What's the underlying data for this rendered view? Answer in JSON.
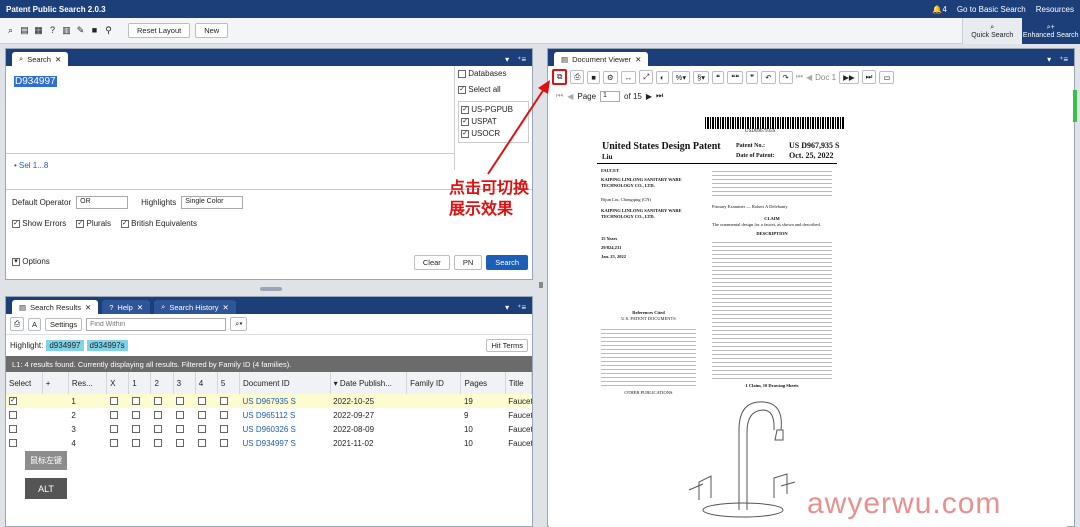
{
  "app": {
    "title": "Patent Public Search 2.0.3",
    "notif_count": "4",
    "basic_search_link": "Go to Basic Search",
    "resources": "Resources"
  },
  "toolbar": {
    "reset_layout": "Reset Layout",
    "new": "New",
    "quick_search": "Quick Search",
    "enhanced_search": "Enhanced Search"
  },
  "search": {
    "tab": "Search",
    "query": "D934997",
    "set_link": "• Sel 1...8",
    "databases_label": "Databases",
    "select_all": "Select all",
    "dbs": [
      "US-PGPUB",
      "USPAT",
      "USOCR"
    ],
    "default_operator_label": "Default Operator",
    "default_operator": "OR",
    "highlights_label": "Highlights",
    "highlights": "Single Color",
    "show_errors": "Show Errors",
    "plurals": "Plurals",
    "british": "British Equivalents",
    "options": "Options",
    "clear": "Clear",
    "pn": "PN",
    "search_btn": "Search"
  },
  "results": {
    "tab_results": "Search Results",
    "tab_help": "Help",
    "tab_history": "Search History",
    "settings": "Settings",
    "find_within_placeholder": "Find Within",
    "highlight_label": "Highlight:",
    "chips": [
      "d934997",
      "d934997s"
    ],
    "hit_terms": "Hit Terms",
    "summary": "L1: 4 results found. Currently displaying all results. Filtered by Family ID (4 families).",
    "columns": [
      "Select",
      "+",
      "Res...",
      "X",
      "1",
      "2",
      "3",
      "4",
      "5",
      "Document ID",
      "Date Publish...",
      "Family ID",
      "Pages",
      "Title"
    ],
    "rows": [
      {
        "n": "1",
        "doc": "US D967935 S",
        "date": "2022-10-25",
        "pages": "19",
        "title": "Faucet"
      },
      {
        "n": "2",
        "doc": "US D965112 S",
        "date": "2022-09-27",
        "pages": "9",
        "title": "Faucet"
      },
      {
        "n": "3",
        "doc": "US D960326 S",
        "date": "2022-08-09",
        "pages": "10",
        "title": "Faucet"
      },
      {
        "n": "4",
        "doc": "US D934997 S",
        "date": "2021-11-02",
        "pages": "10",
        "title": "Faucet"
      }
    ],
    "mouse_key": "鼠标左键",
    "alt_key": "ALT"
  },
  "viewer": {
    "tab": "Document Viewer",
    "doc_label": "Doc 1",
    "page_label": "Page",
    "page_value": "1",
    "of_pages": "of 15"
  },
  "annotation": {
    "line1": "点击可切换",
    "line2": "展示效果"
  },
  "patent": {
    "barcode_text": "USD0967935S",
    "kind": "United States Design Patent",
    "inventor": "Liu",
    "patent_no_label": "Patent No.:",
    "patent_no": "US D967,935 S",
    "date_label": "Date of Patent:",
    "date": "Oct. 25, 2022",
    "field54": "FAUCET",
    "applicant": "KAIPING LINLONG SANITARY WARE TECHNOLOGY CO., LTD.",
    "assignee": "KAIPING LINLONG SANITARY WARE TECHNOLOGY CO., LTD.",
    "inventor_full": "Bijun Liu, Chongqing (CN)",
    "term": "15 Years",
    "appl": "29/824,231",
    "filed": "Jan. 25, 2022",
    "claim_head": "CLAIM",
    "claim": "The ornamental design for a faucet, as shown and described.",
    "desc_head": "DESCRIPTION",
    "refs_head": "References Cited",
    "us_docs": "U.S. PATENT DOCUMENTS",
    "other_pubs": "OTHER PUBLICATIONS",
    "footer": "1 Claim, 10 Drawing Sheets",
    "examiner": "Primary Examiner — Robert A Delehanty"
  },
  "watermark": "awyerwu.com"
}
